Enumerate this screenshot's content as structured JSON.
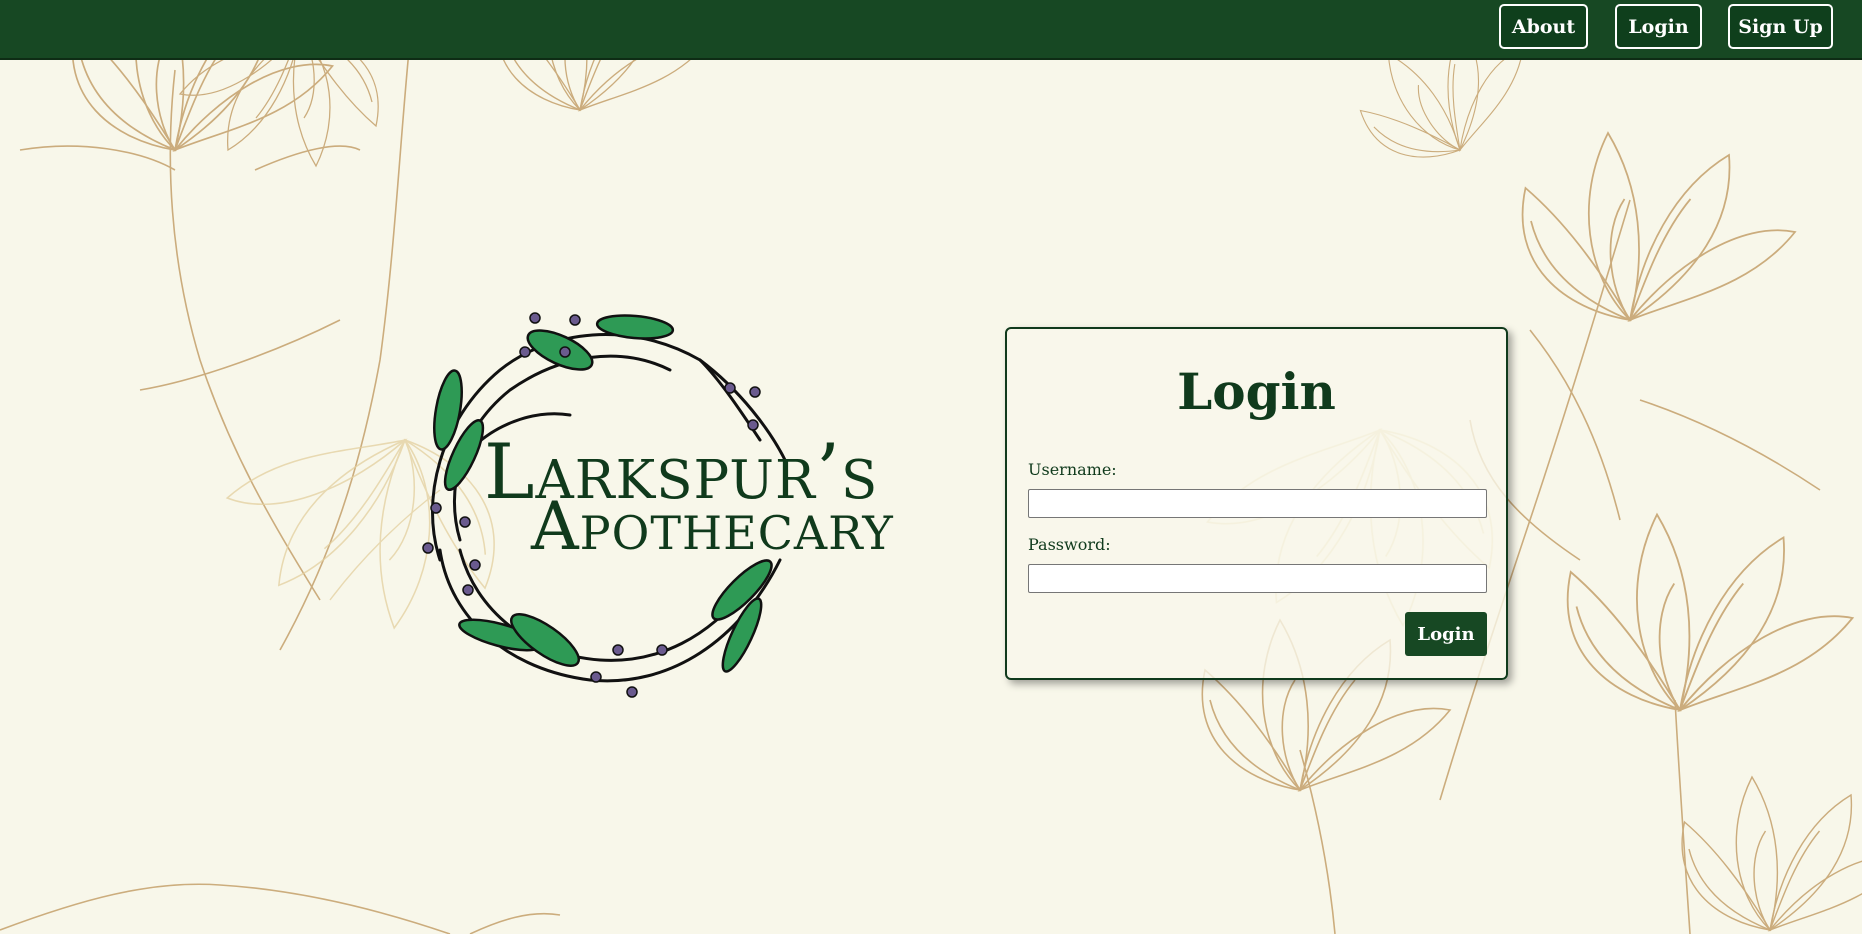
{
  "nav": {
    "about_label": "About",
    "login_label": "Login",
    "signup_label": "Sign Up"
  },
  "logo": {
    "line1": "Larkspur’s",
    "line2": "Apothecary"
  },
  "login_form": {
    "title": "Login",
    "username_label": "Username:",
    "username_value": "",
    "password_label": "Password:",
    "password_value": "",
    "submit_label": "Login"
  },
  "colors": {
    "primary_green": "#174823",
    "dark_green": "#103a1c",
    "background": "#f8f7ea",
    "floral_gold": "#c4a06a",
    "leaf_green": "#2e9a55",
    "berry_purple": "#6a5a8e"
  },
  "icons": {
    "background": "floral-line-art",
    "logo": "berry-wreath"
  }
}
